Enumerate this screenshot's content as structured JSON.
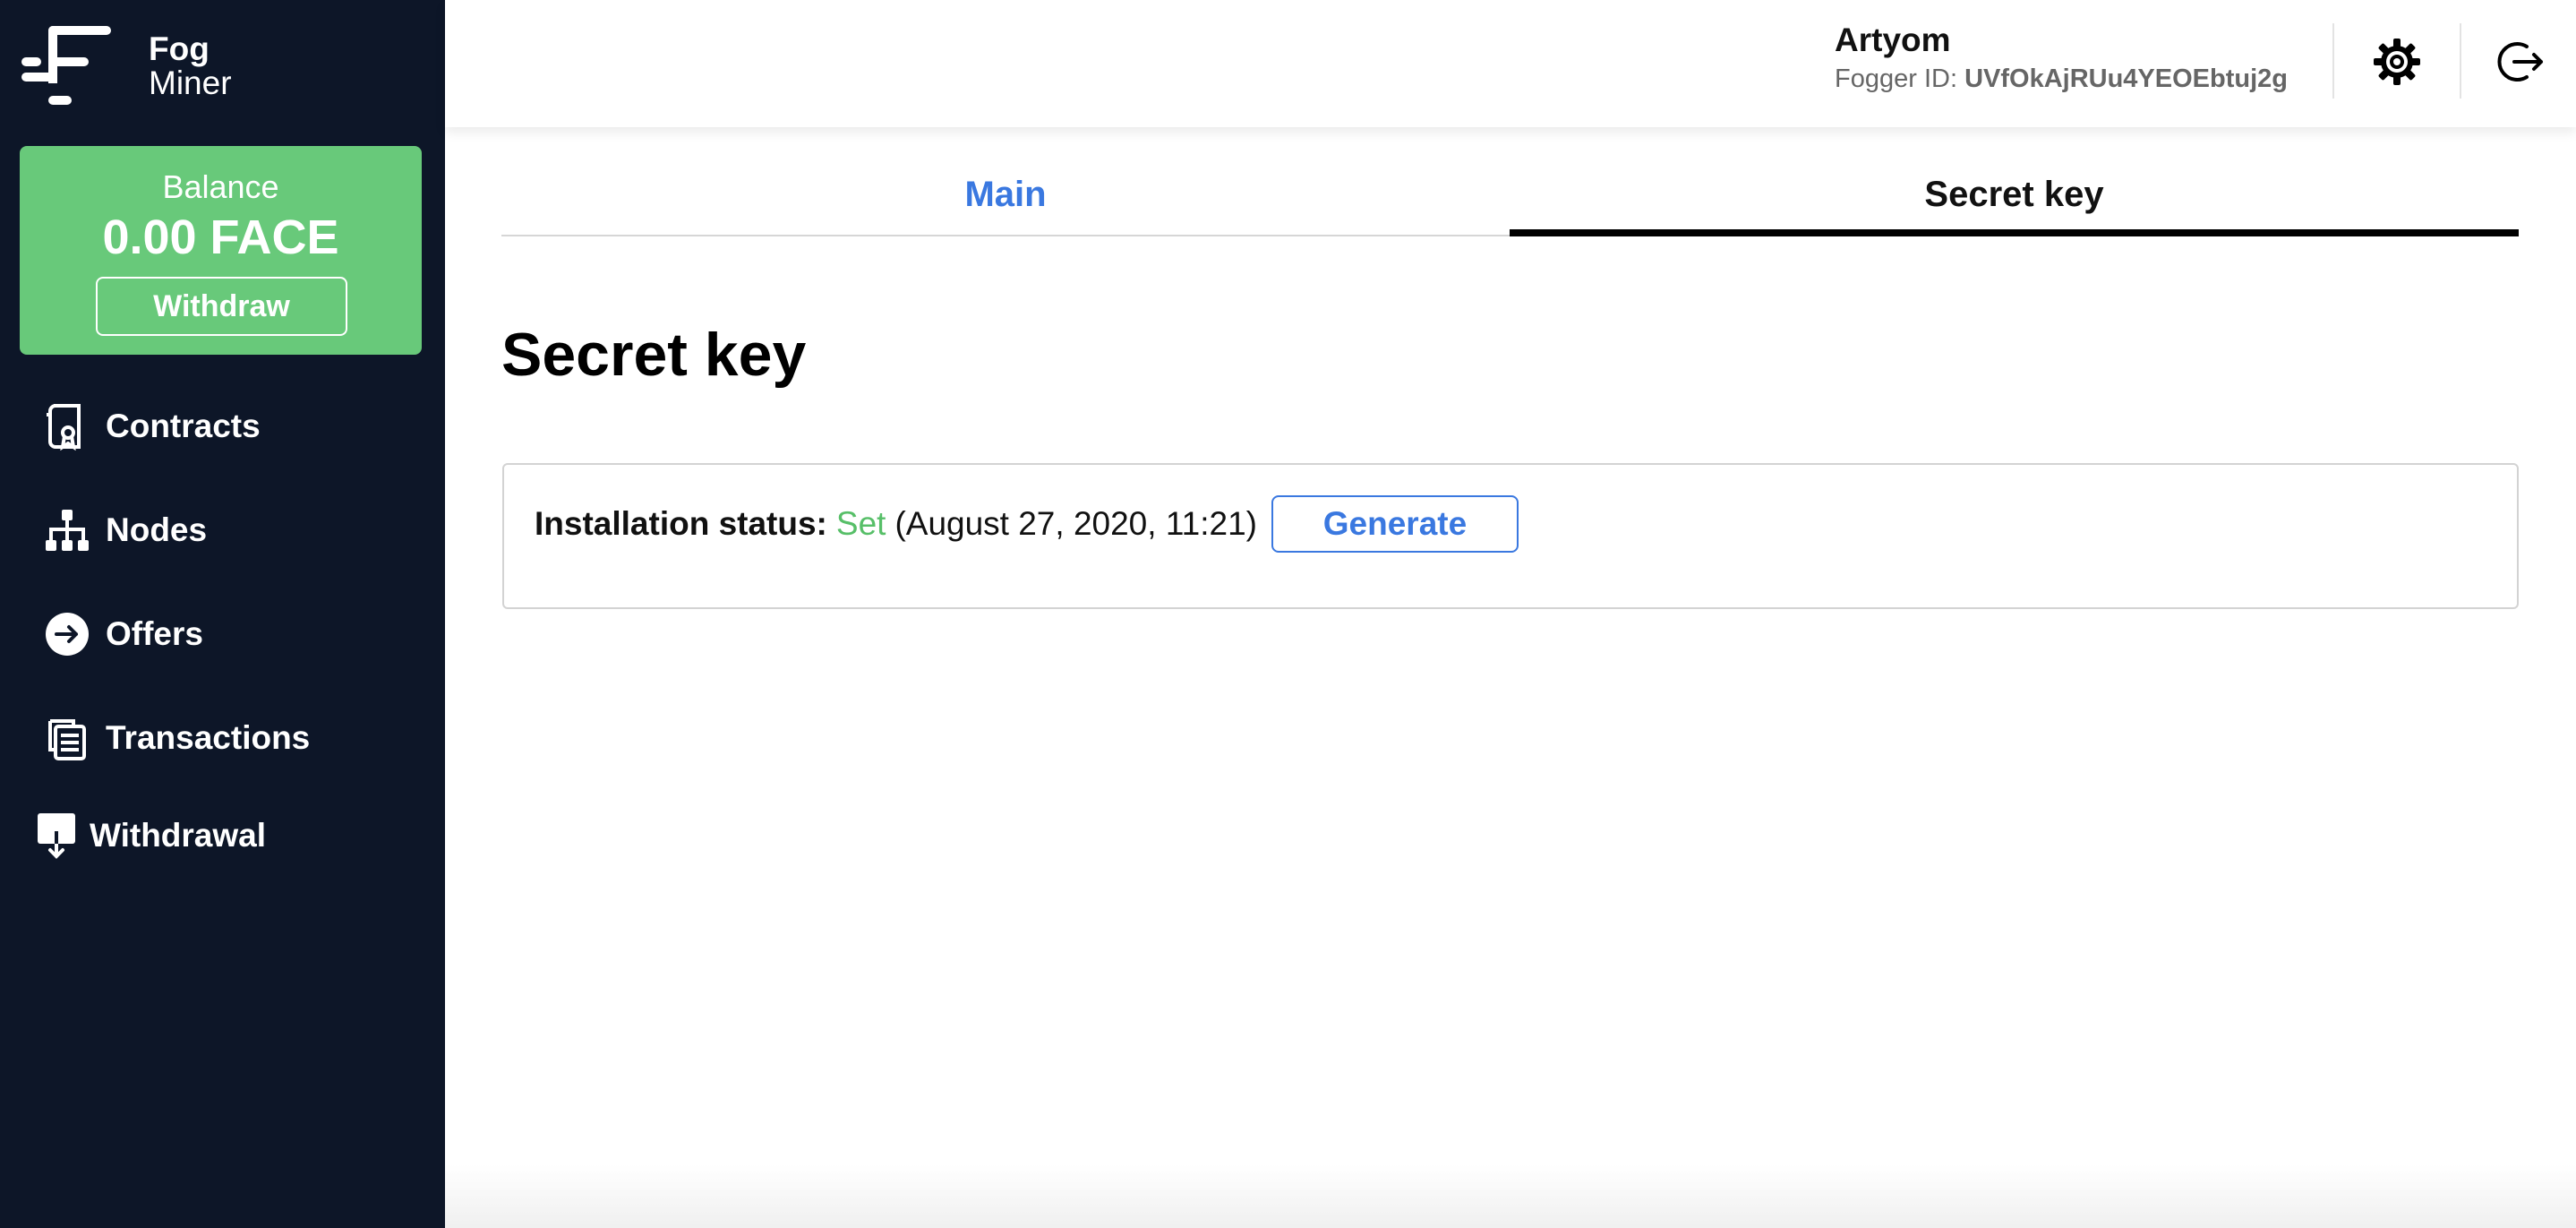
{
  "app": {
    "name_line1": "Fog",
    "name_line2": "Miner"
  },
  "balance": {
    "label": "Balance",
    "value": "0.00 FACE",
    "withdraw_label": "Withdraw"
  },
  "sidebar": {
    "items": [
      {
        "label": "Contracts",
        "icon": "contract-icon"
      },
      {
        "label": "Nodes",
        "icon": "nodes-icon"
      },
      {
        "label": "Offers",
        "icon": "arrow-circle-icon"
      },
      {
        "label": "Transactions",
        "icon": "documents-icon"
      },
      {
        "label": "Withdrawal",
        "icon": "download-icon"
      }
    ]
  },
  "header": {
    "user_name": "Artyom",
    "fogger_label": "Fogger ID:",
    "fogger_id": "UVfOkAjRUu4YEOEbtuj2g",
    "settings_icon": "gear-icon",
    "logout_icon": "logout-icon"
  },
  "tabs": [
    {
      "label": "Main",
      "active": false
    },
    {
      "label": "Secret key",
      "active": true
    }
  ],
  "content": {
    "title": "Secret key",
    "status_label": "Installation status:",
    "status_value": "Set",
    "status_date": "(August 27, 2020, 11:21)",
    "generate_label": "Generate"
  },
  "colors": {
    "sidebar_bg": "#0d1628",
    "balance_bg": "#68c97a",
    "accent_blue": "#3a78e0",
    "status_green": "#57bf68"
  }
}
